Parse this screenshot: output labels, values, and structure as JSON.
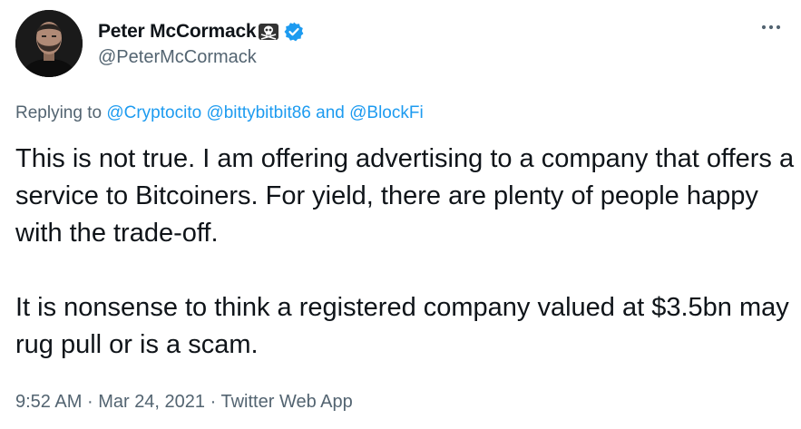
{
  "author": {
    "display_name": "Peter McCormack",
    "handle": "@PeterMcCormack",
    "verified": true,
    "name_emoji": "skull-and-crossbones-icon"
  },
  "reply": {
    "prefix": "Replying to",
    "mentions": [
      "@Cryptocito",
      "@bittybitbit86",
      "@BlockFi"
    ],
    "conjunction": "and"
  },
  "tweet": {
    "paragraph_1": "This is not true. I am offering advertising to a company that offers a service to Bitcoiners. For yield, there are plenty of people happy with the trade-off.",
    "paragraph_2": "It is nonsense to think a registered company valued at $3.5bn may rug pull or is a scam."
  },
  "meta": {
    "time": "9:52 AM",
    "separator": "·",
    "date": "Mar 24, 2021",
    "source": "Twitter Web App"
  },
  "colors": {
    "text": "#0f1419",
    "secondary": "#536471",
    "link": "#1d9bf0",
    "verified": "#1d9bf0"
  }
}
